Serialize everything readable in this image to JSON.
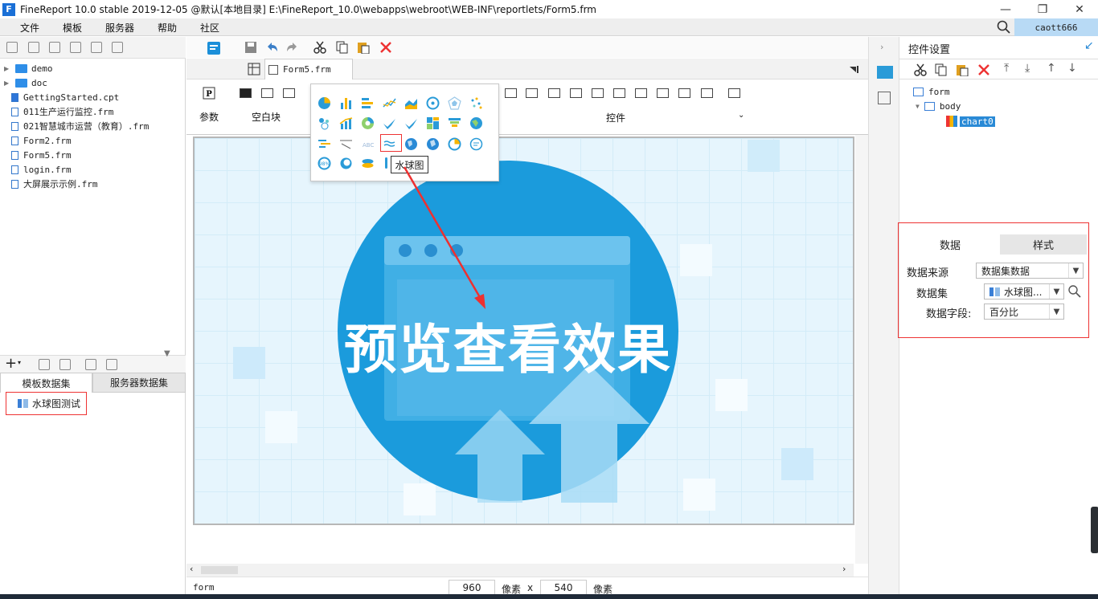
{
  "titlebar": {
    "title": "FineReport 10.0 stable 2019-12-05 @默认[本地目录]     E:\\FineReport_10.0\\webapps\\webroot\\WEB-INF\\reportlets/Form5.frm",
    "logo_text": "F"
  },
  "menubar": {
    "items": [
      "文件",
      "模板",
      "服务器",
      "帮助",
      "社区"
    ],
    "user": "caott666"
  },
  "file_tree": {
    "items": [
      {
        "label": "demo",
        "type": "folder"
      },
      {
        "label": "doc",
        "type": "folder"
      },
      {
        "label": "GettingStarted.cpt",
        "type": "cpt"
      },
      {
        "label": "011生产运行监控.frm",
        "type": "frm"
      },
      {
        "label": "021智慧城市运营（教育）.frm",
        "type": "frm"
      },
      {
        "label": "Form2.frm",
        "type": "frm"
      },
      {
        "label": "Form5.frm",
        "type": "frm"
      },
      {
        "label": "login.frm",
        "type": "frm"
      },
      {
        "label": "大屏展示示例.frm",
        "type": "frm"
      }
    ]
  },
  "datasets": {
    "tabs": [
      "模板数据集",
      "服务器数据集"
    ],
    "items": [
      "水球图测试"
    ]
  },
  "editor": {
    "file_tab": "Form5.frm",
    "param_label": "参数",
    "blank_label": "空白块",
    "widget_label": "控件",
    "canvas_text": "预览查看效果",
    "tooltip": "水球图"
  },
  "statusbar": {
    "component": "form",
    "width": "960",
    "unit1": "像素",
    "times": "x",
    "height": "540",
    "unit2": "像素"
  },
  "right_panel": {
    "title": "控件设置",
    "tree": [
      "form",
      "body",
      "chart0"
    ],
    "tabs": [
      "数据",
      "样式"
    ],
    "fields": {
      "source_label": "数据来源",
      "source_value": "数据集数据",
      "dataset_label": "数据集",
      "dataset_value": "水球图...",
      "field_label": "数据字段:",
      "field_value": "百分比"
    }
  },
  "colors": {
    "accent": "#1b8fd9",
    "highlight": "#e33333",
    "user_badge": "#b8daf5"
  }
}
